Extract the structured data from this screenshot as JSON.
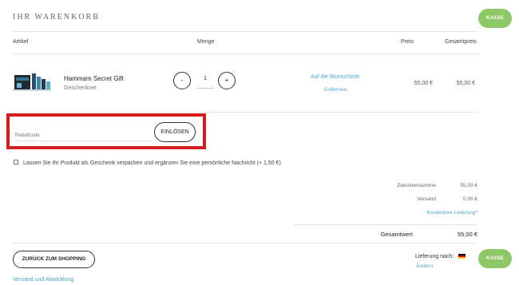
{
  "cart": {
    "title": "IHR WARENKORB",
    "checkout_label": "KASSE"
  },
  "table": {
    "headers": {
      "article": "Artikel",
      "quantity": "Menge",
      "price": "Preis",
      "total": "Gesamtpreis"
    }
  },
  "items": [
    {
      "name": "Hammam Secret Gift",
      "subtitle": "Geschenkset",
      "quantity": "1",
      "minus_label": "-",
      "plus_label": "+",
      "wishlist_label": "Auf die Wunschliste",
      "remove_label": "Entfernen",
      "price": "55,00 €",
      "total": "55,00 €"
    }
  ],
  "coupon": {
    "placeholder": "Rabattcode",
    "redeem_label": "EINLÖSEN"
  },
  "gift": {
    "text": "Lassen Sie Ihr Produkt als Geschenk verpacken und ergänzen Sie eine persönliche Nachricht (+ 1,50 €)",
    "checked": false
  },
  "summary": {
    "subtotal_label": "Zwischensumme",
    "subtotal_value": "55,00 €",
    "shipping_label": "Versand",
    "shipping_value": "0,00 €",
    "free_shipping_note": "Kostenlose Lieferung*",
    "grand_total_label": "Gesamtwert",
    "grand_total_value": "55,00 €"
  },
  "footer": {
    "back_label": "ZURÜCK ZUM SHOPPING",
    "shipping_info_link": "Versand und Abwicklung",
    "delivery_label": "Lieferung nach:",
    "change_label": "Ändern",
    "delivery_country_flag": "flag-germany-icon"
  },
  "colors": {
    "accent_green": "#8cc866",
    "link_blue": "#4aa3c8",
    "highlight_red": "#d51b1b"
  }
}
